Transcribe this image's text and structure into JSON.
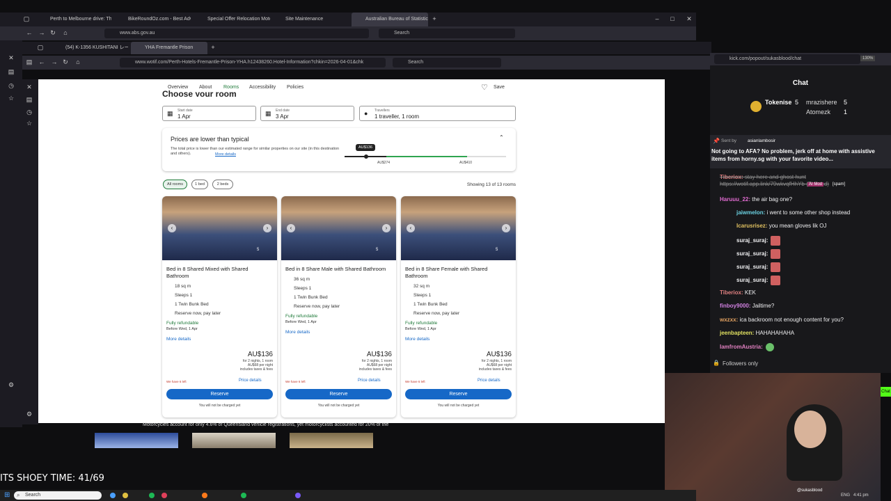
{
  "outer_browser": {
    "tabs": [
      "Perth to Melbourne drive: The ...",
      "BikeRoundOz.com - Best Advic...",
      "Special Offer Relocation Motor...",
      "Site Maintenance",
      "Australian Bureau of Statistics"
    ],
    "url": "www.abs.gov.au",
    "search_placeholder": "Search"
  },
  "inner_browser": {
    "tabs": [
      "(54) K-1356 KUSHITANI レーフのヨ...",
      "YHA Fremantle Prison"
    ],
    "url": "www.wotif.com/Perth-Hotels-Fremantle-Prison-YHA.h12438260.Hotel-Information?chkin=2026-04-01&chk",
    "search_placeholder": "Search"
  },
  "subnav": {
    "items": [
      "Overview",
      "About",
      "Rooms",
      "Accessibility",
      "Policies"
    ],
    "save_label": "Save"
  },
  "heading": "Choose your room",
  "search_fields": {
    "start_label": "Start date",
    "start_value": "1 Apr",
    "end_label": "End date",
    "end_value": "3 Apr",
    "travellers_label": "Travellers",
    "travellers_value": "1 traveller, 1 room"
  },
  "price_banner": {
    "title": "Prices are lower than typical",
    "body": "The total price is lower than our estimated range for similar properties on our site (in this destination and others).",
    "more_details": "More details",
    "marker": "AU$136",
    "low_label": "AU$274",
    "high_label": "AU$410"
  },
  "filters": {
    "chips": [
      "All rooms",
      "1 bed",
      "2 beds"
    ],
    "showing": "Showing 13 of 13 rooms"
  },
  "rooms": [
    {
      "title": "Bed in 8 Shared Mixed with Shared Bathroom",
      "size": "18 sq m",
      "sleeps": "Sleeps 1",
      "bed": "1 Twin Bunk Bed",
      "reserve_note": "Reserve now, pay later",
      "refundable": "Fully refundable",
      "before": "Before Wed, 1 Apr",
      "more": "More details",
      "price": "AU$136",
      "price_note": "for 2 nights, 1 room\nAU$68 per night\nincludes taxes & fees",
      "left": "We have 6 left",
      "price_details": "Price details",
      "reserve": "Reserve",
      "charge_note": "You will not be charged yet",
      "photo_count": "5"
    },
    {
      "title": "Bed in 8 Share Male with Shared Bathroom",
      "size": "36 sq m",
      "sleeps": "Sleeps 1",
      "bed": "1 Twin Bunk Bed",
      "reserve_note": "Reserve now, pay later",
      "refundable": "Fully refundable",
      "before": "Before Wed, 1 Apr",
      "more": "More details",
      "price": "AU$136",
      "price_note": "for 2 nights, 1 room\nAU$68 per night\nincludes taxes & fees",
      "left": "We have 6 left",
      "price_details": "Price details",
      "reserve": "Reserve",
      "charge_note": "You will not be charged yet",
      "photo_count": "5"
    },
    {
      "title": "Bed in 8 Share Female with Shared Bathroom",
      "size": "32 sq m",
      "sleeps": "Sleeps 1",
      "bed": "1 Twin Bunk Bed",
      "reserve_note": "Reserve now, pay later",
      "refundable": "Fully refundable",
      "before": "Before Wed, 1 Apr",
      "more": "More details",
      "price": "AU$136",
      "price_note": "for 2 nights, 1 room\nAU$68 per night\nincludes taxes & fees",
      "left": "We have 6 left",
      "price_details": "Price details",
      "reserve": "Reserve",
      "charge_note": "You will not be charged yet",
      "photo_count": "5"
    }
  ],
  "bottom_text": "Motorcycles account for only 4.6% of Queensland vehicle registrations, yet motorcyclists accounted for 20% of the",
  "chat": {
    "url": "kick.com/popout/sukasblood/chat",
    "zoom": "130%",
    "title": "Chat",
    "top_gifters": [
      {
        "name": "Tokenise",
        "count": "5"
      },
      {
        "name": "mrazishere",
        "count": "5"
      },
      {
        "name": "Atomezk",
        "count": "1"
      }
    ],
    "pinned_sender_label": "Sent by",
    "pinned_sender": "asianlambosir",
    "pinned_text": "Not going to AFA? No problem, jerk off at home with assistive items from horny.sg with your favorite video...",
    "messages": [
      {
        "user": "Tiberiox:",
        "text": "stay here and ghost hunt https://wotif.app.link/79wkvqfHhYb (Deleted)",
        "color": "#e08080"
      },
      {
        "user": "Haruuu_22:",
        "text": "the air bag one?",
        "color": "#e06bd0"
      },
      {
        "user": "jaiwmelon:",
        "text": "i went to some other shop instead",
        "color": "#6ad0e0"
      },
      {
        "user": "Icarusrisez:",
        "text": "you mean gloves lik OJ",
        "color": "#e0c060"
      },
      {
        "user": "suraj_suraj:",
        "text": "",
        "color": "#e0e0e0"
      },
      {
        "user": "suraj_suraj:",
        "text": "",
        "color": "#e0e0e0"
      },
      {
        "user": "suraj_suraj:",
        "text": "",
        "color": "#e0e0e0"
      },
      {
        "user": "suraj_suraj:",
        "text": "",
        "color": "#e0e0e0"
      },
      {
        "user": "Tiberiox:",
        "text": "KEK",
        "color": "#e08080"
      },
      {
        "user": "finboy9000:",
        "text": "Jailtime?",
        "color": "#d080e0"
      },
      {
        "user": "wxzxx:",
        "text": "ica backroom not enough content for you?",
        "color": "#e0a060"
      },
      {
        "user": "jeenbapteen:",
        "text": "HAHAHAHAHA",
        "color": "#e0e060"
      },
      {
        "user": "IamfromAustria:",
        "text": "",
        "color": "#e080c0"
      }
    ],
    "mod_tag": "AI Mod",
    "spam_tag": "[spam]",
    "followers_only": "Followers only",
    "chat_button": "Chat"
  },
  "overlay": {
    "shoey": "ITS SHOEY TIME: 41/69",
    "cam_handle": "@sukasblood"
  },
  "taskbar": {
    "search": "Search",
    "lang": "ENG",
    "time": "4:41 pm"
  }
}
